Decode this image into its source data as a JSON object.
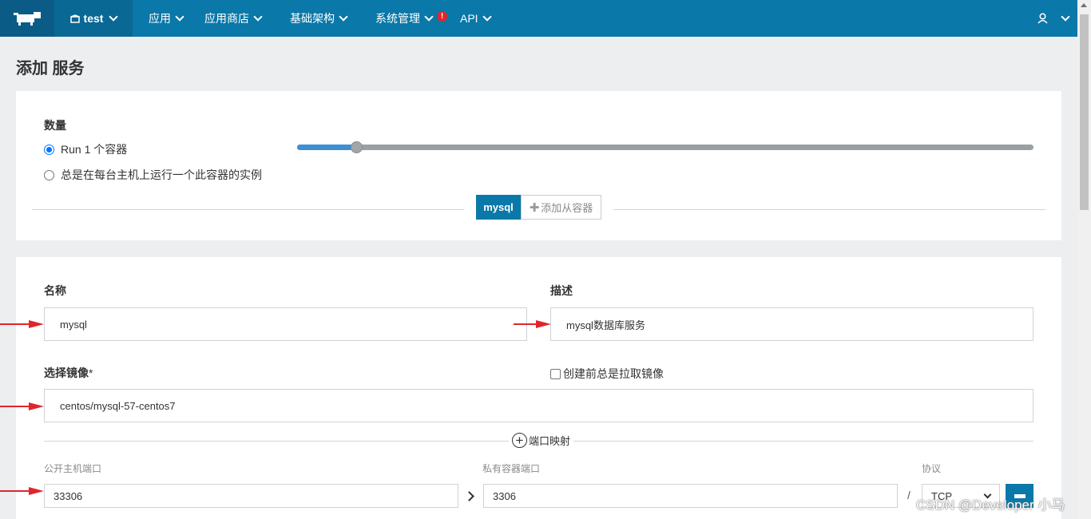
{
  "nav": {
    "env_label": "test",
    "items": [
      {
        "label": "应用"
      },
      {
        "label": "应用商店"
      },
      {
        "label": "基础架构"
      },
      {
        "label": "系统管理"
      },
      {
        "label": "API"
      }
    ],
    "alert_badge": "!"
  },
  "page": {
    "title": "添加 服务"
  },
  "scale": {
    "label": "数量",
    "options": [
      {
        "label": "Run 1 个容器",
        "checked": true
      },
      {
        "label": "总是在每台主机上运行一个此容器的实例",
        "checked": false
      }
    ],
    "slider_fraction": 0.08
  },
  "container_tabs": {
    "active": "mysql",
    "add_label": "添加从容器"
  },
  "form": {
    "name_label": "名称",
    "name_value": "mysql",
    "description_label": "描述",
    "description_value": "mysql数据库服务",
    "image_label": "选择镜像",
    "image_required": "*",
    "image_value": "centos/mysql-57-centos7",
    "pull_image_label": "创建前总是拉取镜像",
    "pull_image_checked": false,
    "port_mapping_label": "端口映射",
    "public_port_label": "公开主机端口",
    "private_port_label": "私有容器端口",
    "protocol_label": "协议",
    "public_port_value": "33306",
    "private_port_value": "3306",
    "protocol_value": "TCP",
    "port_separator": "/"
  },
  "watermark": "CSDN @Developer 小马",
  "colors": {
    "nav_bg": "#0a78a8",
    "accent": "#0a78a8",
    "arrow_red": "#e0262c"
  }
}
